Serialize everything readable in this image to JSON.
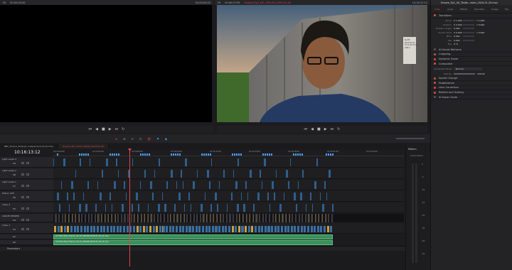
{
  "source_viewer": {
    "zoom": "Fit",
    "timecode_a": "00:00:00:00",
    "timecode_b": "00:00:00:00"
  },
  "timeline_viewer": {
    "zoom": "Fit",
    "timecode_a": "00:00:07:09",
    "clip_name": "Empire_Ep1_UK...050-04_2023-02-18",
    "timecode_b": "10:16:13:12",
    "slate": [
      "SLATE",
      "2023-02-18",
      "TC 10:16:13:12",
      "CAM A"
    ]
  },
  "inspector": {
    "title": "Empire_Ep1_UK_Textle...aster_2024-01-29.mov",
    "tabs": [
      "Video",
      "Audio",
      "Effects",
      "Transition",
      "Image",
      "File"
    ],
    "sections": [
      {
        "label": "Transform",
        "on": true
      },
      {
        "label": "Cropping",
        "on": true
      },
      {
        "label": "Dynamic Zoom",
        "on": true
      },
      {
        "label": "Composite",
        "on": true
      },
      {
        "label": "Speed Change",
        "on": true
      },
      {
        "label": "Stabilization",
        "on": true
      },
      {
        "label": "Lens Correction",
        "on": true
      },
      {
        "label": "Retime and Scaling",
        "on": true
      },
      {
        "label": "AI Super Scale",
        "on": false
      }
    ],
    "transform_fields": [
      {
        "label": "Zoom",
        "x": "X 1.000",
        "y": "Y 1.000"
      },
      {
        "label": "Position",
        "x": "X 0.000",
        "y": "Y 0.000"
      },
      {
        "label": "Rotation Angle",
        "x": "0.000",
        "y": ""
      },
      {
        "label": "Anchor Point",
        "x": "X 0.000",
        "y": "Y 0.000"
      },
      {
        "label": "Pitch",
        "x": "0.000",
        "y": ""
      },
      {
        "label": "Yaw",
        "x": "0.000",
        "y": ""
      },
      {
        "label": "Flip",
        "x": "",
        "y": ""
      }
    ],
    "smart_reframe": "AI Smart Reframe",
    "composite_mode_label": "Composite Mode",
    "composite_mode": "Normal",
    "opacity_label": "Opacity",
    "opacity": "100.00"
  },
  "timeline": {
    "tabs": [
      "BBC_Empire_Entered_Independent_Production",
      "Empire_Ep1_UK-TX_DRAW_2024-01-29"
    ],
    "timecode": "10:16:13:12",
    "ruler": [
      "10:16:00:00",
      "10:16:03:00",
      "10:16:06:00",
      "10:16:09:00",
      "10:16:12:00",
      "10:16:15:00",
      "10:16:18:00",
      "10:16:21:00",
      "10:16:24:00"
    ],
    "tracks": [
      {
        "id": "V9",
        "name": "Light Leaks 3"
      },
      {
        "id": "V8",
        "name": "Light Leaks 2"
      },
      {
        "id": "V7",
        "name": "Light Leaks 1"
      },
      {
        "id": "V6",
        "name": "Motion GFX"
      },
      {
        "id": "V5",
        "name": "Video 3"
      },
      {
        "id": "V4",
        "name": "GRADE RENDER"
      },
      {
        "id": "V3",
        "name": "Video 1"
      },
      {
        "id": "A1",
        "name": ""
      },
      {
        "id": "A2",
        "name": ""
      }
    ],
    "audio_clips": [
      "A1 S102_Ep1_Empire_UK_TX_GRADE_2024-01-29_v3.mov",
      "A2 S102_Ep1_Empire_UK_TX_GRADE_2024-01-29_v3.mov"
    ],
    "parameters_label": "Parameters"
  },
  "meters": {
    "title": "Meters",
    "label": "Control Room",
    "scale": [
      "0",
      "-5",
      "-10",
      "-15",
      "-20",
      "-30",
      "-40",
      "-50"
    ]
  },
  "colors": {
    "accent": "#e0444b",
    "video_clip": "#2e5f8e",
    "audio_clip": "#3b8f5a",
    "marker": "#4a9bff"
  }
}
